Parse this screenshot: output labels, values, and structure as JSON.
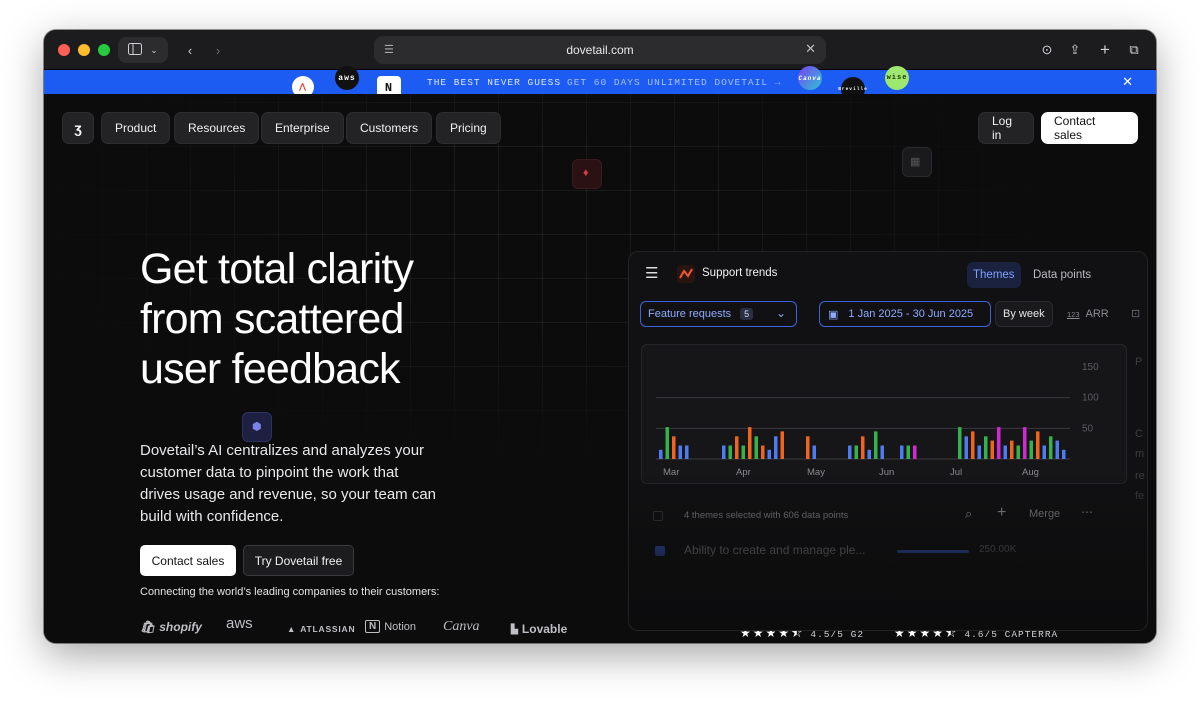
{
  "browser": {
    "url": "dovetail.com",
    "colors": {
      "close": "#ff5f57",
      "minimize": "#febc2e",
      "maximize": "#28c840"
    }
  },
  "banner": {
    "text_left": "THE BEST NEVER GUESS",
    "text_right": "GET 60 DAYS UNLIMITED DOVETAIL →",
    "logos": [
      "aws",
      "N",
      "Canva",
      "Breville",
      "wise"
    ],
    "close_icon": "close-icon",
    "color": "#1d5cf3"
  },
  "nav": {
    "items": [
      "Product",
      "Resources",
      "Enterprise",
      "Customers",
      "Pricing"
    ],
    "login": "Log in",
    "contact": "Contact sales"
  },
  "hero": {
    "title": "Get total clarity from scattered user feedback",
    "subtitle": "Dovetail’s AI centralizes and analyzes your customer data to pinpoint the work that drives usage and revenue, so your team can build with confidence.",
    "cta_primary": "Contact sales",
    "cta_secondary": "Try Dovetail free",
    "connecting": "Connecting the world’s leading companies to their customers:"
  },
  "brands": [
    "shopify",
    "aws",
    "ATLASSIAN",
    "Notion",
    "Canva",
    "Lovable"
  ],
  "ratings": [
    {
      "stars": "★★★★⯪",
      "label": "4.5/5 G2"
    },
    {
      "stars": "★★★★⯪",
      "label": "4.6/5 CAPTERRA"
    }
  ],
  "panel": {
    "title": "Support trends",
    "tabs": [
      "Themes",
      "Data points"
    ],
    "active_tab": "Themes",
    "filter": {
      "label": "Feature requests",
      "count": "5"
    },
    "date_range": "1 Jan 2025 - 30 Jun 2025",
    "granularity": "By week",
    "metric": "ARR",
    "metric_icon": "123",
    "footer": "4 themes selected with 606 data points",
    "merge": "Merge",
    "row": "Ability to create and manage ple...",
    "row_value": "250.00K",
    "side_letters": [
      "P",
      "C",
      "m",
      "re",
      "fe"
    ]
  },
  "chart_data": {
    "type": "bar",
    "title": "",
    "xlabel": "",
    "ylabel": "",
    "x": [
      "Mar",
      "Apr",
      "May",
      "Jun",
      "Jul",
      "Aug"
    ],
    "ylim": [
      0,
      150
    ],
    "yticks": [
      50,
      100,
      150
    ],
    "grid": true,
    "series_colors": {
      "blue": "#4f7bf1",
      "green": "#35b24a",
      "orange": "#f0641e",
      "magenta": "#d327d6"
    },
    "groups": [
      [
        [
          "blue",
          15
        ],
        [
          "green",
          52
        ],
        [
          "orange",
          37
        ],
        [
          "blue",
          22
        ],
        [
          "blue",
          22
        ]
      ],
      [
        [
          "blue",
          22
        ],
        [
          "green",
          22
        ],
        [
          "orange",
          37
        ],
        [
          "green",
          22
        ],
        [
          "orange",
          52
        ],
        [
          "green",
          37
        ],
        [
          "orange",
          22
        ],
        [
          "blue",
          15
        ],
        [
          "blue",
          37
        ],
        [
          "orange",
          45
        ]
      ],
      [
        [
          "orange",
          37
        ],
        [
          "blue",
          22
        ]
      ],
      [
        [
          "blue",
          22
        ],
        [
          "green",
          22
        ],
        [
          "orange",
          37
        ],
        [
          "blue",
          15
        ],
        [
          "green",
          45
        ],
        [
          "blue",
          22
        ]
      ],
      [
        [
          "blue",
          22
        ],
        [
          "green",
          22
        ],
        [
          "magenta",
          22
        ]
      ],
      [
        [
          "green",
          52
        ],
        [
          "blue",
          37
        ],
        [
          "orange",
          45
        ],
        [
          "blue",
          22
        ],
        [
          "green",
          37
        ],
        [
          "orange",
          30
        ],
        [
          "magenta",
          52
        ],
        [
          "blue",
          22
        ],
        [
          "orange",
          30
        ],
        [
          "green",
          22
        ],
        [
          "magenta",
          52
        ],
        [
          "green",
          30
        ],
        [
          "orange",
          45
        ],
        [
          "blue",
          22
        ],
        [
          "green",
          37
        ],
        [
          "blue",
          30
        ],
        [
          "blue",
          15
        ]
      ]
    ]
  }
}
